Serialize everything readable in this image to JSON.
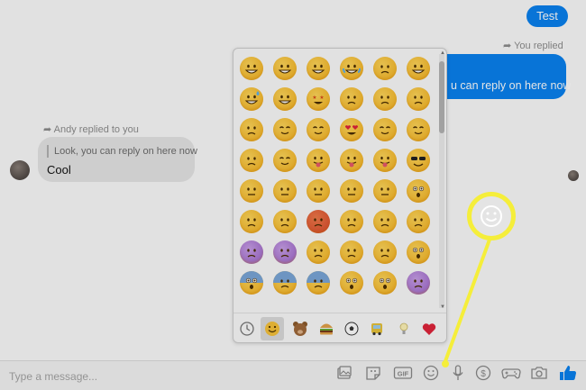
{
  "messages": {
    "sent_test": "Test",
    "you_replied_label": "You replied",
    "reply_text": "u can reply on here now",
    "andy_replied_label": "Andy replied to you",
    "quoted_text": "Look, you can reply on here now",
    "received_text": "Cool"
  },
  "composer": {
    "placeholder": "Type a message..."
  },
  "picker": {
    "tabs": [
      "clock-icon",
      "smiley-icon",
      "bear-icon",
      "burger-icon",
      "soccer-icon",
      "car-icon",
      "bulb-icon",
      "heart-icon"
    ],
    "selected_tab": "smiley-icon"
  },
  "toolbar_icons": [
    "photo-icon",
    "sticker-icon",
    "gif-icon",
    "emoji-icon",
    "microphone-icon",
    "payment-icon",
    "game-icon",
    "camera-icon",
    "like-icon"
  ],
  "colors": {
    "accent": "#0a82f0",
    "highlight": "#f5ee3a",
    "heart": "#e0243a"
  }
}
